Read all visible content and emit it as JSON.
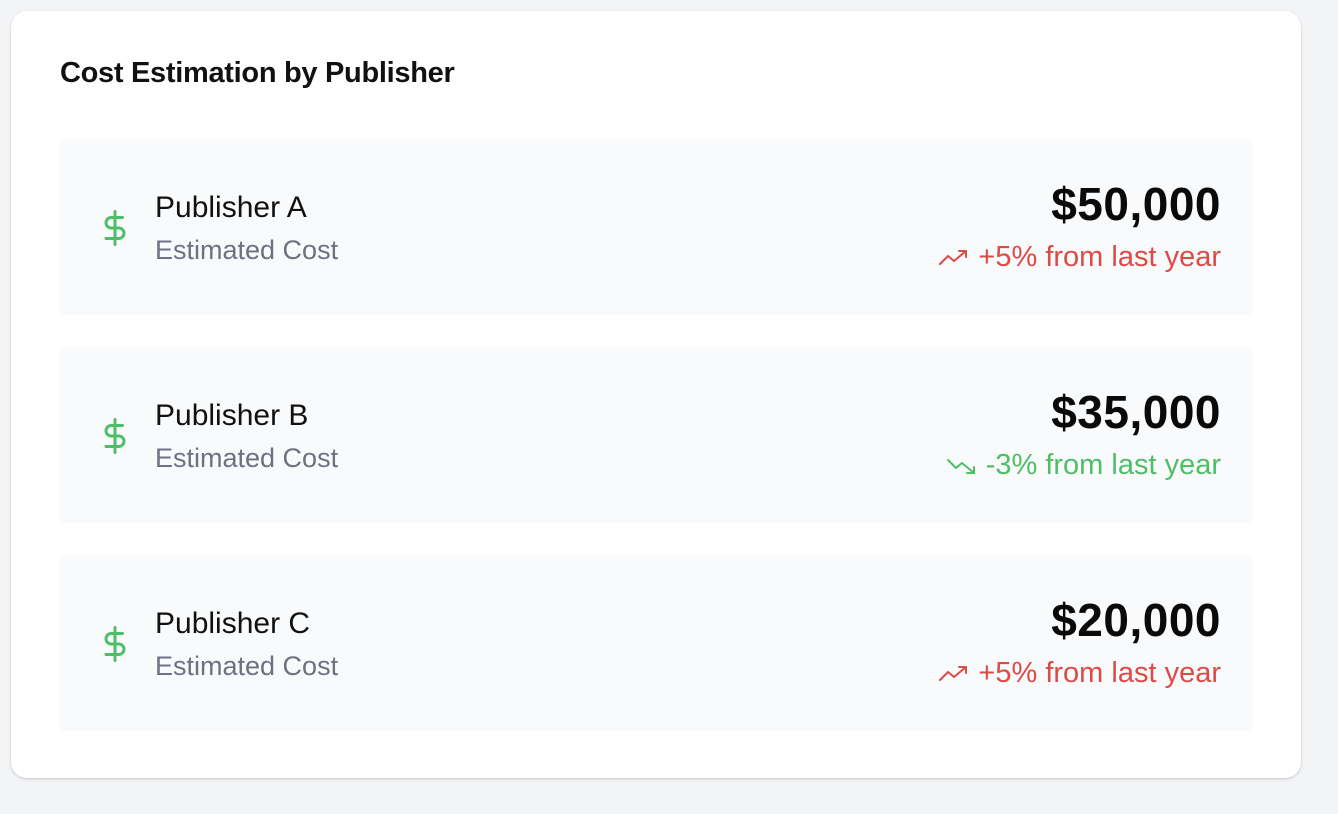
{
  "card": {
    "title": "Cost Estimation by Publisher"
  },
  "colors": {
    "increase": "#dc4b45",
    "decrease": "#4fbf67",
    "icon": "#4fbf67",
    "row_bg": "#f9fafb"
  },
  "publishers": [
    {
      "name": "Publisher A",
      "subtitle": "Estimated Cost",
      "amount": "$50,000",
      "change": "+5% from last year",
      "direction": "up",
      "icon": "dollar-icon",
      "trend_icon": "trending-up-icon"
    },
    {
      "name": "Publisher B",
      "subtitle": "Estimated Cost",
      "amount": "$35,000",
      "change": "-3% from last year",
      "direction": "down",
      "icon": "dollar-icon",
      "trend_icon": "trending-down-icon"
    },
    {
      "name": "Publisher C",
      "subtitle": "Estimated Cost",
      "amount": "$20,000",
      "change": "+5% from last year",
      "direction": "up",
      "icon": "dollar-icon",
      "trend_icon": "trending-up-icon"
    }
  ]
}
